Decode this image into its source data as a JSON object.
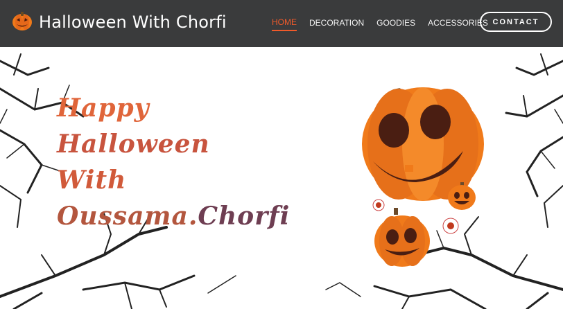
{
  "header": {
    "logo_icon": "pumpkin-icon",
    "title": "Halloween With Chorfi",
    "nav": [
      {
        "label": "HOME",
        "active": true
      },
      {
        "label": "DECORATION",
        "active": false
      },
      {
        "label": "GOODIES",
        "active": false
      },
      {
        "label": "ACCESSORIES",
        "active": false
      }
    ],
    "contact_label": "CONTACT"
  },
  "hero": {
    "line1": "Happy",
    "line2": "Halloween",
    "line3": "With",
    "line4_a": "Oussama.",
    "line4_b": "Chorfi",
    "illustration": "jack-o-lantern-illustration"
  },
  "colors": {
    "topbar": "#3a3b3c",
    "accent": "#f05a2a",
    "pumpkin": "#f07a1a"
  }
}
